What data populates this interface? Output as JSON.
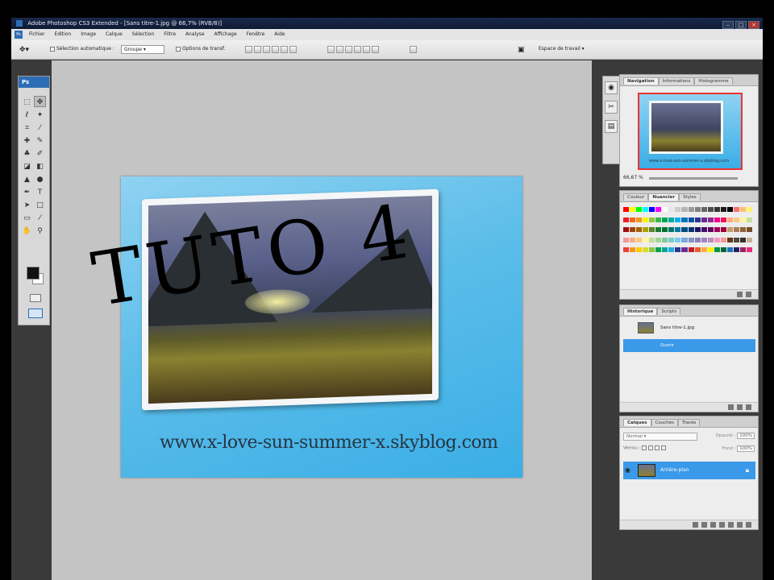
{
  "window": {
    "title": "Adobe Photoshop CS3 Extended - [Sans titre-1.jpg @ 66,7% (RVB/8)]"
  },
  "menu": [
    "Fichier",
    "Edition",
    "Image",
    "Calque",
    "Sélection",
    "Filtre",
    "Analyse",
    "Affichage",
    "Fenêtre",
    "Aide"
  ],
  "options": {
    "auto_select": "Sélection automatique :",
    "auto_select_value": "Groupe",
    "transform": "Options de transf.",
    "workspace": "Espace de travail"
  },
  "toolbox": {
    "badge": "Ps"
  },
  "canvas": {
    "overlay_text": "TUTO 4",
    "url": "www.x-love-sun-summer-x.skyblog.com"
  },
  "navigator": {
    "tabs": [
      "Navigation",
      "Informations",
      "Histogramme"
    ],
    "zoom": "66,67 %",
    "url_mini": "www.x-love-sun-summer-x.skyblog.com"
  },
  "swatches": {
    "tabs": [
      "Couleur",
      "Nuancier",
      "Styles"
    ],
    "colors": [
      "#ff0000",
      "#ffff00",
      "#00ff00",
      "#00ffff",
      "#0000ff",
      "#ff00ff",
      "#ffffff",
      "#e6e6e6",
      "#cccccc",
      "#b3b3b3",
      "#999999",
      "#808080",
      "#666666",
      "#4d4d4d",
      "#333333",
      "#1a1a1a",
      "#000000",
      "#ff6f6f",
      "#ffbf6f",
      "#fff46f",
      "#ed1c24",
      "#f26522",
      "#f7941d",
      "#fff200",
      "#8dc63f",
      "#39b54a",
      "#00a651",
      "#00a99d",
      "#00aeef",
      "#0072bc",
      "#0054a6",
      "#2e3192",
      "#662d91",
      "#92278f",
      "#ec008c",
      "#ed145b",
      "#f9ad81",
      "#fdc68a",
      "#fff799",
      "#c4df9b",
      "#9e0b0f",
      "#a0410d",
      "#a36209",
      "#aba000",
      "#598527",
      "#1a7b30",
      "#007236",
      "#00746b",
      "#0076a3",
      "#004a80",
      "#003471",
      "#1b1464",
      "#440e62",
      "#630460",
      "#9e005d",
      "#9e0039",
      "#c69c6d",
      "#a67c52",
      "#8c6239",
      "#754c24",
      "#f5989d",
      "#f9ad81",
      "#fdc68a",
      "#fff799",
      "#c4df9b",
      "#a3d39c",
      "#82ca9c",
      "#7accc8",
      "#6dcff6",
      "#7da7d9",
      "#8393ca",
      "#8781bd",
      "#a186be",
      "#bd8cbf",
      "#f49ac1",
      "#f6989d",
      "#603913",
      "#534741",
      "#362f2d",
      "#c7b299",
      "#ef4136",
      "#f7941d",
      "#ffcc00",
      "#d7df23",
      "#8dc63f",
      "#00a14b",
      "#00a79d",
      "#27aae1",
      "#2b3990",
      "#662d91",
      "#be1e2d",
      "#f15a29",
      "#fbb040",
      "#fff200",
      "#009444",
      "#006838",
      "#1c75bc",
      "#262262",
      "#9e1f63",
      "#ee2a7b"
    ]
  },
  "history": {
    "tabs": [
      "Historique",
      "Scripts"
    ],
    "snapshot": "Sans titre-1.jpg",
    "step": "Ouvrir"
  },
  "layers": {
    "tabs": [
      "Calques",
      "Couches",
      "Tracés"
    ],
    "blend": "Normal",
    "opacity_label": "Opacité :",
    "opacity": "100%",
    "lock_label": "Verrou :",
    "fill_label": "Fond :",
    "fill": "100%",
    "layer_name": "Arrière-plan"
  }
}
